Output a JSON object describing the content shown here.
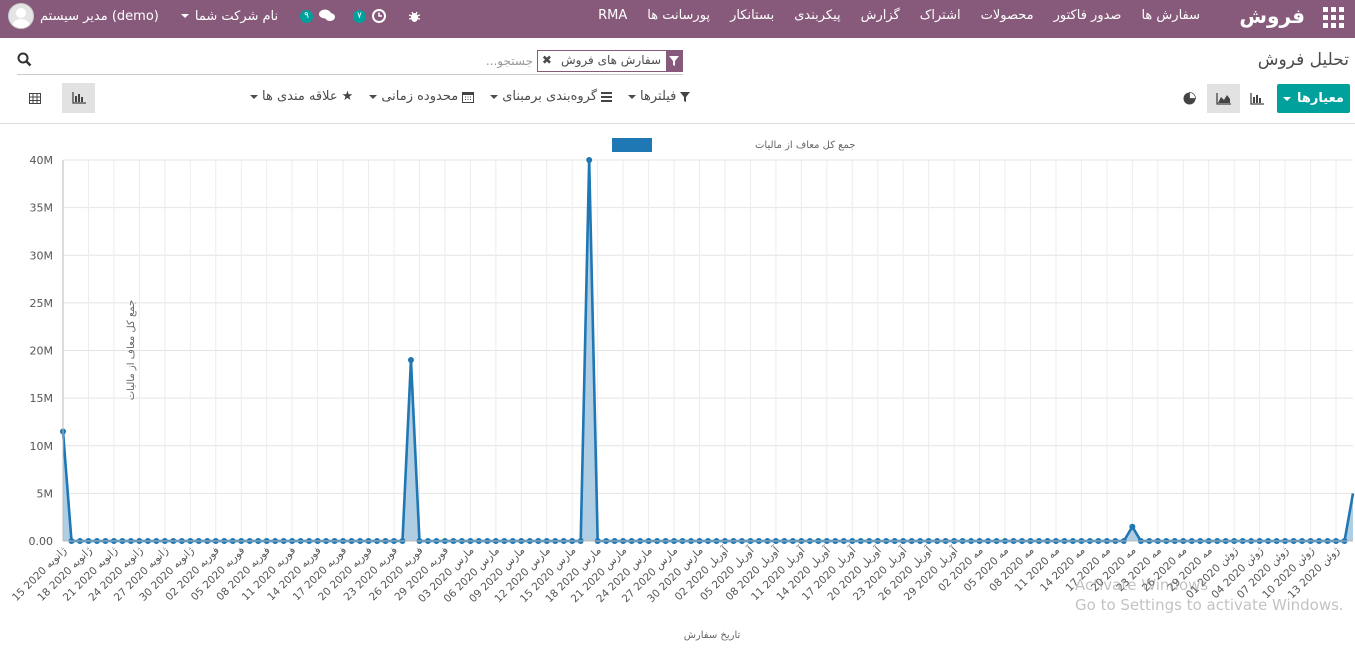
{
  "navbar": {
    "brand": "فروش",
    "menu": [
      "سفارش ها",
      "صدور فاکتور",
      "محصولات",
      "اشتراک",
      "گزارش",
      "پیکربندی",
      "بستانکار",
      "پورسانت ها",
      "RMA"
    ],
    "user": "مدیر سیستم (demo)",
    "company": "نام شرکت شما",
    "messages_count": "۹",
    "activities_count": "۷"
  },
  "page": {
    "title": "تحلیل فروش"
  },
  "search": {
    "facet": "سفارش های فروش",
    "placeholder": "جستجو..."
  },
  "toolbar": {
    "measures": "معیارها",
    "filters": "فیلترها",
    "groupby": "گروه‌بندی برمبنای",
    "timerange": "محدوده زمانی",
    "favorites": "علاقه مندی ها"
  },
  "chart_data": {
    "type": "area",
    "legend": "جمع کل معاف از مالیات",
    "ylabel": "جمع کل معاف از مالیات",
    "xlabel": "تاریخ سفارش",
    "ylim": [
      0,
      40000000
    ],
    "yticks": [
      "0.00",
      "5M",
      "10M",
      "15M",
      "20M",
      "25M",
      "30M",
      "35M",
      "40M"
    ],
    "x_labels": [
      "15 ژانویه 2020",
      "18 ژانویه 2020",
      "21 ژانویه 2020",
      "24 ژانویه 2020",
      "27 ژانویه 2020",
      "30 ژانویه 2020",
      "02 فوریه 2020",
      "05 فوریه 2020",
      "08 فوریه 2020",
      "11 فوریه 2020",
      "14 فوریه 2020",
      "17 فوریه 2020",
      "20 فوریه 2020",
      "23 فوریه 2020",
      "26 فوریه 2020",
      "29 فوریه 2020",
      "03 مارس 2020",
      "06 مارس 2020",
      "09 مارس 2020",
      "12 مارس 2020",
      "15 مارس 2020",
      "18 مارس 2020",
      "21 مارس 2020",
      "24 مارس 2020",
      "27 مارس 2020",
      "30 مارس 2020",
      "02 آوریل 2020",
      "05 آوریل 2020",
      "08 آوریل 2020",
      "11 آوریل 2020",
      "14 آوریل 2020",
      "17 آوریل 2020",
      "20 آوریل 2020",
      "23 آوریل 2020",
      "26 آوریل 2020",
      "29 آوریل 2020",
      "02 مه 2020",
      "05 مه 2020",
      "08 مه 2020",
      "11 مه 2020",
      "14 مه 2020",
      "17 مه 2020",
      "20 مه 2020",
      "23 مه 2020",
      "26 مه 2020",
      "29 مه 2020",
      "01 ژوئن 2020",
      "04 ژوئن 2020",
      "07 ژوئن 2020",
      "10 ژوئن 2020",
      "13 ژوئن 2020"
    ],
    "days": 152,
    "points": [
      {
        "day": 0,
        "value": 11500000
      },
      {
        "day": 41,
        "value": 19000000
      },
      {
        "day": 62,
        "value": 40000000
      },
      {
        "day": 126,
        "value": 1500000
      },
      {
        "day": 152,
        "value": 5000000
      }
    ],
    "colors": {
      "line": "#1f77b4",
      "fill": "#a6c8e0"
    }
  },
  "watermark": {
    "line1": "Activate Windows",
    "line2": "Go to Settings to activate Windows."
  }
}
